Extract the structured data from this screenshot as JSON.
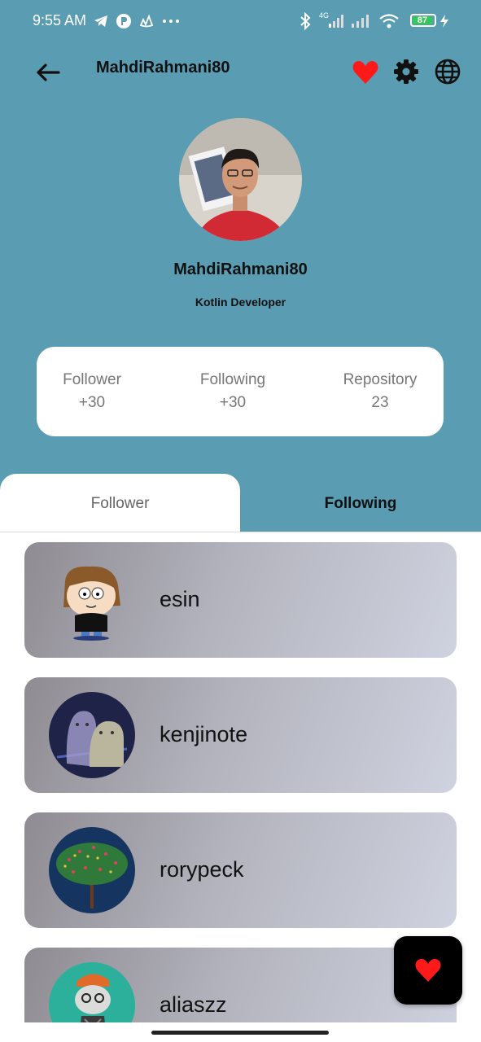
{
  "status_bar": {
    "time": "9:55 AM",
    "network_label": "4G",
    "battery_percent": "87",
    "icons": [
      "telegram-icon",
      "app-icon",
      "boat-icon",
      "more-dots-icon",
      "bluetooth-icon",
      "signal-icon",
      "signal-icon",
      "wifi-icon",
      "battery-icon",
      "charging-icon"
    ]
  },
  "app_bar": {
    "title": "MahdiRahmani80",
    "icons": [
      "back-arrow-icon",
      "favorite-heart-icon",
      "settings-gear-icon",
      "language-globe-icon"
    ]
  },
  "profile": {
    "name": "MahdiRahmani80",
    "bio": "Kotlin Developer"
  },
  "stats": [
    {
      "label": "Follower",
      "value": "+30"
    },
    {
      "label": "Following",
      "value": "+30"
    },
    {
      "label": "Repository",
      "value": "23"
    }
  ],
  "tabs": [
    {
      "label": "Follower",
      "selected": true
    },
    {
      "label": "Following",
      "selected": false
    }
  ],
  "users": [
    {
      "username": "esin",
      "avatar": "cartoon-avatar"
    },
    {
      "username": "kenjinote",
      "avatar": "ghost-avatar"
    },
    {
      "username": "rorypeck",
      "avatar": "tree-avatar"
    },
    {
      "username": "aliaszz",
      "avatar": "cat-avatar"
    }
  ],
  "fab": {
    "icon": "heart-icon"
  },
  "colors": {
    "header_bg": "#5a9db3",
    "heart": "#ff1a1a",
    "fab_bg": "#000000"
  }
}
